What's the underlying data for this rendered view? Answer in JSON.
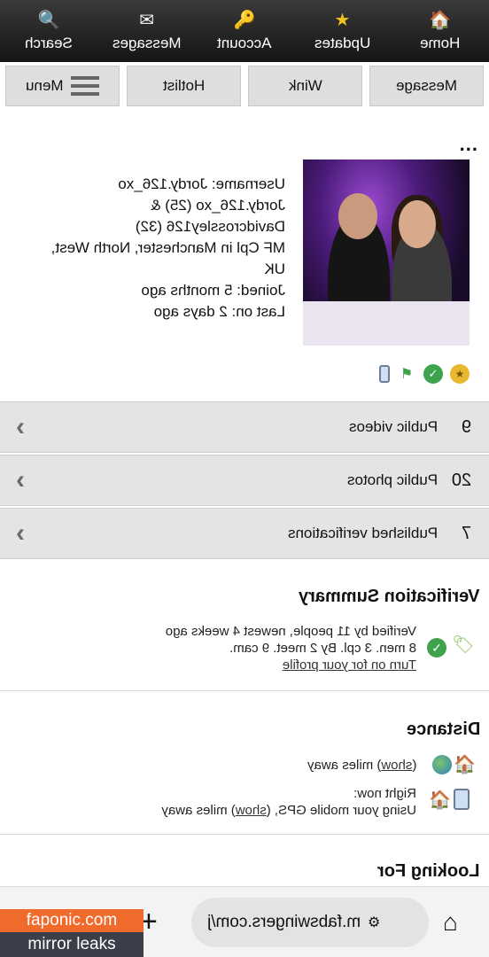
{
  "topnav": {
    "items": [
      {
        "label": "Home",
        "icon": "home-icon"
      },
      {
        "label": "Updates",
        "icon": "star-icon"
      },
      {
        "label": "Account",
        "icon": "key-icon"
      },
      {
        "label": "Messages",
        "icon": "envelope-icon"
      },
      {
        "label": "Search",
        "icon": "magnifier-icon"
      }
    ]
  },
  "actions": {
    "message": "Message",
    "wink": "Wink",
    "hotlist": "Hotlist",
    "menu": "Menu"
  },
  "more": "...",
  "profile": {
    "username_line": "Username: Jordy.126_xo",
    "names_line1": "Jordy.126_xo (25) &",
    "names_line2": "Davidcrossley126 (32)",
    "location_line1": "MF Cpl in Manchester, North West,",
    "location_line2": "UK",
    "joined": "Joined: 5 months ago",
    "last_on": "Last on: 2 days ago"
  },
  "sections": [
    {
      "count": "9",
      "label": "Public videos"
    },
    {
      "count": "20",
      "label": "Public photos"
    },
    {
      "count": "7",
      "label": "Published verifications"
    }
  ],
  "verification": {
    "title": "Verification Summary",
    "line1": "Verified by 11 people, newest 4 weeks ago",
    "line2": "8 men. 3 cpl. By 2 meet. 9 cam.",
    "link": "Turn on for your profile"
  },
  "distance": {
    "title": "Distance",
    "row1_prefix": "(",
    "row1_show": "show",
    "row1_suffix": ") miles away",
    "row2_line1": "Right now:",
    "row2_prefix": "Using your mobile GPS, (",
    "row2_show": "show",
    "row2_suffix": ") miles away"
  },
  "looking_for": {
    "title": "Looking For"
  },
  "browser": {
    "url": "m.fabswingers.com/j",
    "plus": "+"
  },
  "watermark": {
    "line1": "faponic.com",
    "line2": "mirror leaks"
  }
}
